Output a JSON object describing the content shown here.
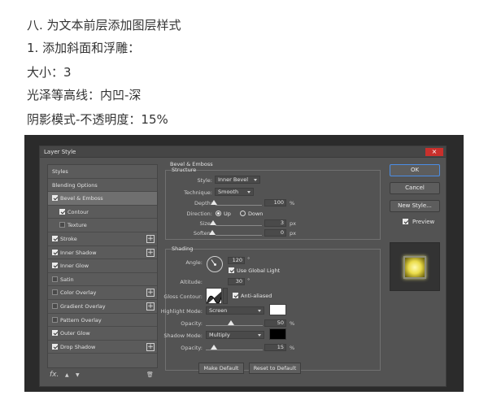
{
  "article": {
    "line1": "八. 为文本前层添加图层样式",
    "line2": "1. 添加斜面和浮雕：",
    "line3": "大小：3",
    "line4": "光泽等高线：内凹-深",
    "line5": "阴影模式-不透明度：15%"
  },
  "dialog": {
    "title": "Layer Style",
    "close": "×"
  },
  "styles_list": [
    {
      "label": "Styles"
    },
    {
      "label": "Blending Options"
    },
    {
      "label": "Bevel & Emboss",
      "checked": true,
      "selected": true
    },
    {
      "label": "Contour",
      "checked": true,
      "sub": true
    },
    {
      "label": "Texture",
      "checked": false,
      "sub": true
    },
    {
      "label": "Stroke",
      "checked": true,
      "plus": "+"
    },
    {
      "label": "Inner Shadow",
      "checked": true,
      "plus": "+"
    },
    {
      "label": "Inner Glow",
      "checked": true
    },
    {
      "label": "Satin",
      "checked": false
    },
    {
      "label": "Color Overlay",
      "checked": false,
      "plus": "+"
    },
    {
      "label": "Gradient Overlay",
      "checked": false,
      "plus": "+"
    },
    {
      "label": "Pattern Overlay",
      "checked": false
    },
    {
      "label": "Outer Glow",
      "checked": true
    },
    {
      "label": "Drop Shadow",
      "checked": true,
      "plus": "+"
    }
  ],
  "footer": {
    "fx": "fx.",
    "up": "▲",
    "down": "▼",
    "trash": "🗑"
  },
  "bevel": {
    "header": "Bevel & Emboss",
    "structure": "Structure",
    "style_label": "Style:",
    "style_value": "Inner Bevel",
    "technique_label": "Technique:",
    "technique_value": "Smooth",
    "depth_label": "Depth:",
    "depth_value": "100",
    "depth_unit": "%",
    "direction_label": "Direction:",
    "dir_up": "Up",
    "dir_down": "Down",
    "size_label": "Size:",
    "size_value": "3",
    "size_unit": "px",
    "soften_label": "Soften:",
    "soften_value": "0",
    "soften_unit": "px"
  },
  "shading": {
    "header": "Shading",
    "angle_label": "Angle:",
    "angle_value": "120",
    "angle_unit": "°",
    "global_light": "Use Global Light",
    "altitude_label": "Altitude:",
    "altitude_value": "30",
    "altitude_unit": "°",
    "gloss_label": "Gloss Contour:",
    "anti_aliased": "Anti-aliased",
    "highlight_label": "Highlight Mode:",
    "highlight_value": "Screen",
    "highlight_color": "#ffffff",
    "hopacity_label": "Opacity:",
    "hopacity_value": "50",
    "hopacity_unit": "%",
    "shadow_label": "Shadow Mode:",
    "shadow_value": "Multiply",
    "shadow_color": "#000000",
    "sopacity_label": "Opacity:",
    "sopacity_value": "15",
    "sopacity_unit": "%"
  },
  "buttons": {
    "make_default": "Make Default",
    "reset_default": "Reset to Default",
    "ok": "OK",
    "cancel": "Cancel",
    "new_style": "New Style...",
    "preview": "Preview"
  }
}
